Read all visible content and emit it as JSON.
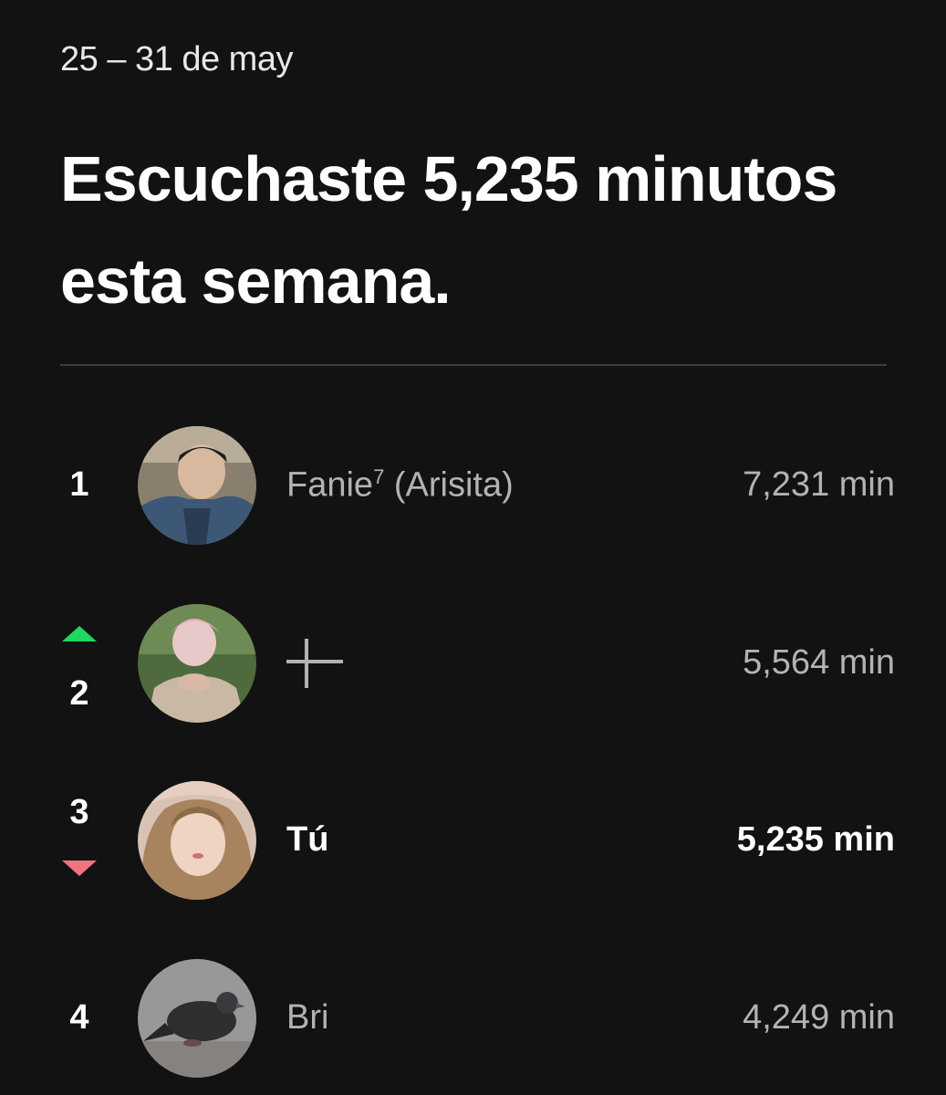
{
  "header": {
    "date_range": "25 – 31 de may",
    "headline": "Escuchaste 5,235 minutos esta semana."
  },
  "leaderboard": [
    {
      "rank": "1",
      "name": "Fanie",
      "name_sup": "7",
      "name_suffix": " (Arisita)",
      "minutes": "7,231 min",
      "trend": "none",
      "avatar": "friend-photo-1",
      "is_me": false
    },
    {
      "rank": "2",
      "name": "",
      "minutes": "5,564 min",
      "trend": "up",
      "avatar": "friend-photo-2",
      "is_me": false,
      "name_icon": "cross-symbol-icon"
    },
    {
      "rank": "3",
      "name": "Tú",
      "minutes": "5,235 min",
      "trend": "down",
      "avatar": "user-photo",
      "is_me": true
    },
    {
      "rank": "4",
      "name": "Bri",
      "minutes": "4,249 min",
      "trend": "none",
      "avatar": "pigeon-photo",
      "is_me": false
    }
  ],
  "colors": {
    "background": "#121212",
    "trend_up": "#1ed760",
    "trend_down": "#f3727f",
    "muted_text": "#b3b3b3"
  }
}
